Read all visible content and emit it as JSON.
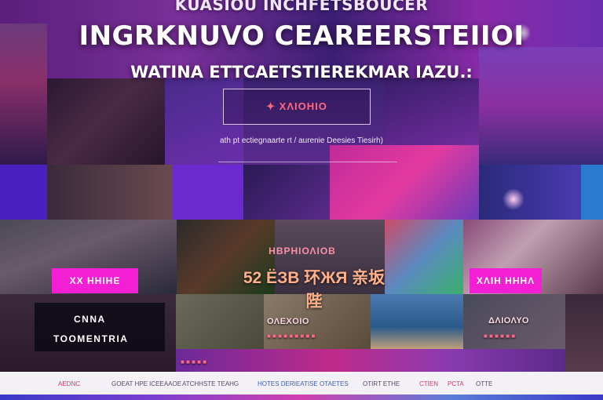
{
  "header": {
    "top_text": "KUASIOU INCHFETSBOUCER",
    "title": "INGRKNUVO CEAREERSTEIIOI",
    "subtitle": "WATINA ETTCAETSTIEREKMAR IAZU.:"
  },
  "hero": {
    "button_label": "✦ ΧΛΙΟΗΙΟ",
    "caption": "ath  pt  ectiegnaarte  rt  / aurenie  Deesies Tiesirh)"
  },
  "featured": {
    "section_title": "ΗΒΡΗΙΟΛΙΟΒ",
    "headline": "52 ЁЗВ 环ЖЯ 亲坂陛",
    "left_button": "ΧΧ ΗΗΙΗΕ",
    "right_button": "ΧΛΙΗ ΗΗΗΛ"
  },
  "brand_card": {
    "line1": "CNNA",
    "line2": "TOOMENTRIA"
  },
  "cards": [
    {
      "label": "ΟΛΕΧΟΙΟ",
      "tag": "■ ■ ■ ■ ■ ■ ■ ■ ■"
    },
    {
      "label": "ΔΛΙΟΛΥΟ",
      "tag": "■ ■ ■ ■ ■ ■"
    },
    {
      "label": "",
      "tag": "■ ■ ■ ■ ■"
    }
  ],
  "footer": {
    "links": [
      "AEDNC",
      "GOEAT HPE ICEEAAOE",
      "ATCHHSTE TEAHG",
      "HOTES DERIEATISE OTAETES",
      "OTIRT ETHE",
      "CTIEN",
      "PCTA",
      "OTTE"
    ]
  },
  "colors": {
    "accent_pink": "#f21fd5",
    "bg_purple": "#1a0b2e",
    "footer_bg": "#f3f1f5"
  }
}
